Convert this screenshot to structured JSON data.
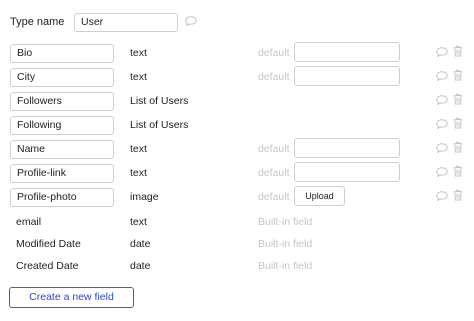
{
  "type": {
    "label": "Type name",
    "value": "User"
  },
  "default_label": "default",
  "builtin_label": "Built-in field",
  "upload_label": "Upload",
  "create_button_label": "Create a new field",
  "fields": [
    {
      "name": "Bio",
      "type": "text",
      "editable": true,
      "default_kind": "input"
    },
    {
      "name": "City",
      "type": "text",
      "editable": true,
      "default_kind": "input"
    },
    {
      "name": "Followers",
      "type": "List of Users",
      "editable": true,
      "default_kind": "none"
    },
    {
      "name": "Following",
      "type": "List of Users",
      "editable": true,
      "default_kind": "none"
    },
    {
      "name": "Name",
      "type": "text",
      "editable": true,
      "default_kind": "input"
    },
    {
      "name": "Profile-link",
      "type": "text",
      "editable": true,
      "default_kind": "input"
    },
    {
      "name": "Profile-photo",
      "type": "image",
      "editable": true,
      "default_kind": "upload"
    },
    {
      "name": "email",
      "type": "text",
      "editable": false,
      "default_kind": "builtin"
    },
    {
      "name": "Modified Date",
      "type": "date",
      "editable": false,
      "default_kind": "builtin"
    },
    {
      "name": "Created Date",
      "type": "date",
      "editable": false,
      "default_kind": "builtin"
    }
  ],
  "colors": {
    "accent": "#3d5bd6",
    "muted_text": "#c6c6c6",
    "icon": "#c4c4c4",
    "border": "#cfcfcf"
  },
  "icons": {
    "comment": "comment-bubble-icon",
    "delete": "trash-icon"
  }
}
